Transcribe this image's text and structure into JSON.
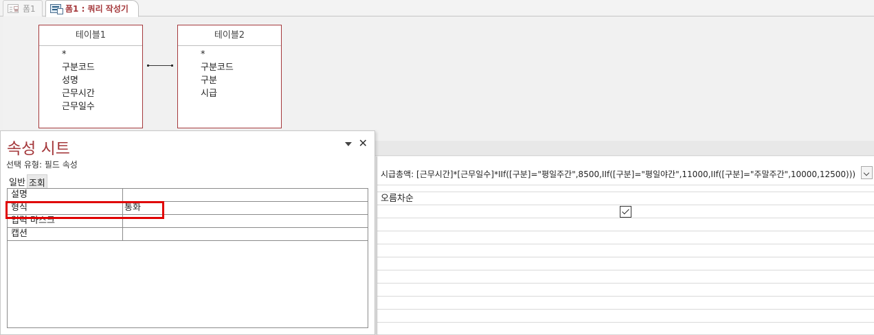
{
  "tabs": [
    {
      "label": "폼1",
      "active": false
    },
    {
      "label": "폼1 : 쿼리 작성기",
      "active": true
    }
  ],
  "tables": [
    {
      "name": "테이블1",
      "fields": [
        "*",
        "구분코드",
        "성명",
        "근무시간",
        "근무일수"
      ]
    },
    {
      "name": "테이블2",
      "fields": [
        "*",
        "구분코드",
        "구분",
        "시급"
      ]
    }
  ],
  "grid": {
    "field_expression": "시급총액: [근무시간]*[근무일수]*IIf([구분]=\"평일주간\",8500,IIf([구분]=\"평일야간\",11000,IIf([구분]=\"주말주간\",10000,12500)))",
    "sort": "오름차순",
    "show": true
  },
  "property_sheet": {
    "title": "속성 시트",
    "selection_type": "선택 유형: 필드 속성",
    "tabs": [
      "일반",
      "조회"
    ],
    "rows": [
      {
        "label": "설명",
        "value": ""
      },
      {
        "label": "형식",
        "value": "통화"
      },
      {
        "label": "입력 마스크",
        "value": ""
      },
      {
        "label": "캡션",
        "value": ""
      }
    ]
  },
  "colors": {
    "accent": "#a4373a",
    "highlight": "#e00000"
  }
}
